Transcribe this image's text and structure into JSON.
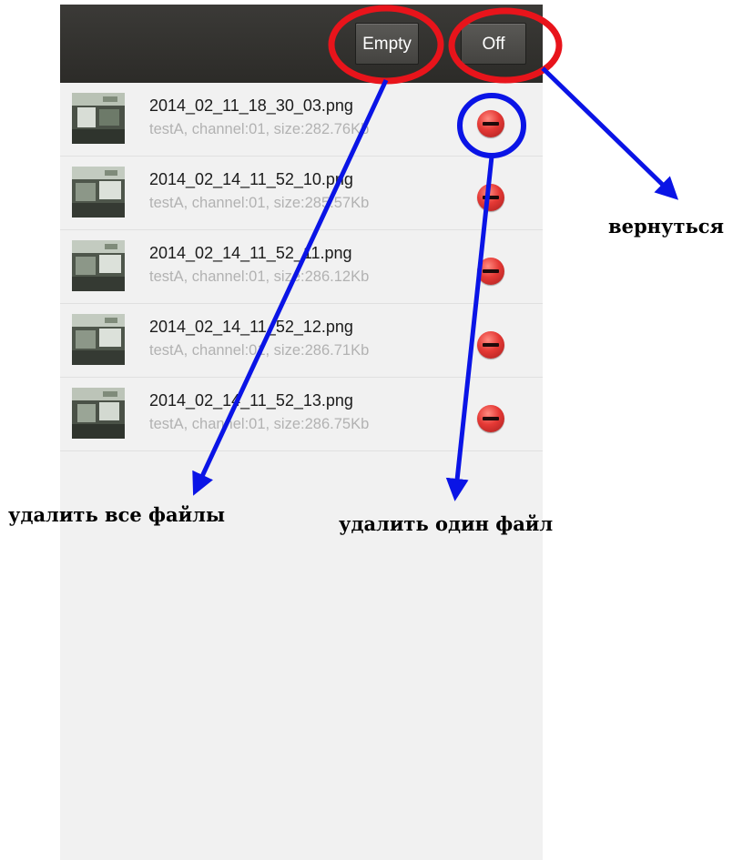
{
  "toolbar": {
    "empty_label": "Empty",
    "off_label": "Off"
  },
  "files": [
    {
      "name": "2014_02_11_18_30_03.png",
      "meta": "testA, channel:01, size:282.76Kb"
    },
    {
      "name": "2014_02_14_11_52_10.png",
      "meta": "testA, channel:01, size:285.57Kb"
    },
    {
      "name": "2014_02_14_11_52_11.png",
      "meta": "testA, channel:01, size:286.12Kb"
    },
    {
      "name": "2014_02_14_11_52_12.png",
      "meta": "testA, channel:01, size:286.71Kb"
    },
    {
      "name": "2014_02_14_11_52_13.png",
      "meta": "testA, channel:01, size:286.75Kb"
    }
  ],
  "annotations": {
    "back": "вернуться",
    "delete_all": "удалить все файлы",
    "delete_one": "удалить один файл"
  },
  "colors": {
    "highlight_ellipse": "#e8141b",
    "pointer_arrow": "#0a14e6",
    "delete_icon": "#e53935",
    "toolbar": "#32312e"
  }
}
